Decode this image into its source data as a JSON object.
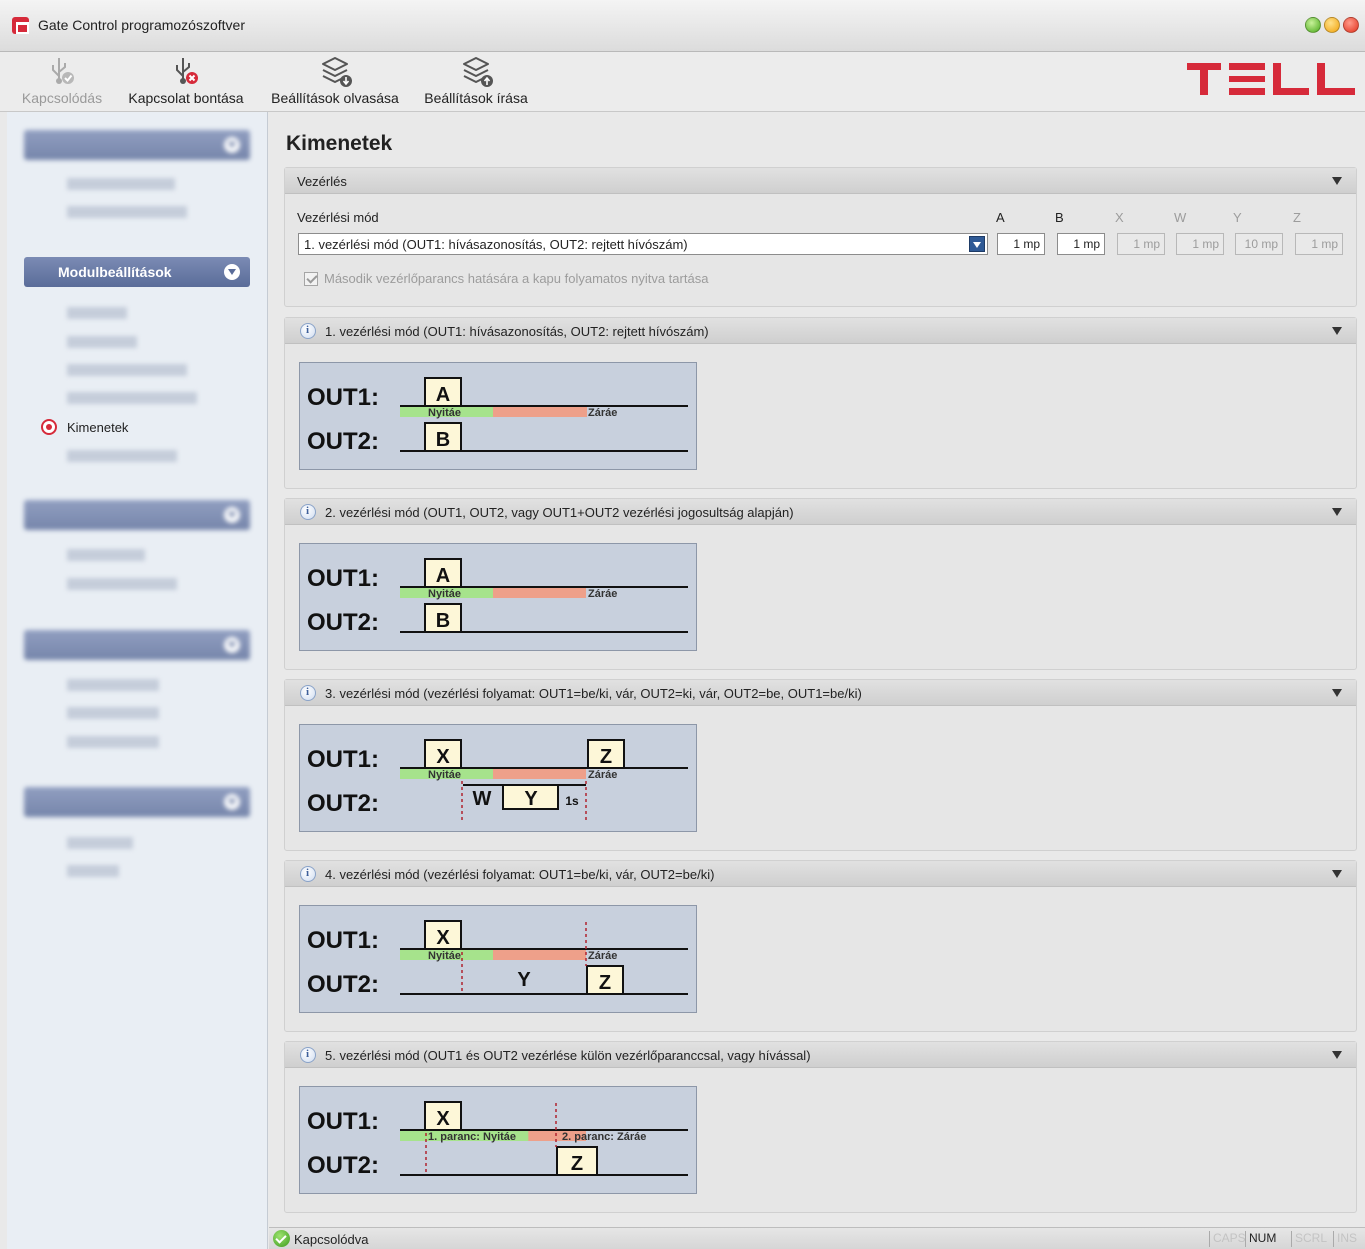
{
  "window": {
    "title": "Gate Control programozószoftver"
  },
  "toolbar": {
    "connect_label": "Kapcsolódás",
    "disconnect_label": "Kapcsolat bontása",
    "read_label": "Beállítások olvasása",
    "write_label": "Beállítások írása",
    "logo_text": "TELL"
  },
  "sidebar": {
    "active_group": "Modulbeállítások",
    "active_item": "Kimenetek"
  },
  "main": {
    "title": "Kimenetek",
    "control": {
      "header": "Vezérlés",
      "mode_label": "Vezérlési mód",
      "mode_value": "1. vezérlési mód   (OUT1: hívásazonosítás, OUT2: rejtett hívószám)",
      "timers": [
        {
          "label": "A",
          "value": "1 mp",
          "enabled": true
        },
        {
          "label": "B",
          "value": "1 mp",
          "enabled": true
        },
        {
          "label": "X",
          "value": "1 mp",
          "enabled": false
        },
        {
          "label": "W",
          "value": "1 mp",
          "enabled": false
        },
        {
          "label": "Y",
          "value": "10 mp",
          "enabled": false
        },
        {
          "label": "Z",
          "value": "1 mp",
          "enabled": false
        }
      ],
      "checkbox_label": "Második vezérlőparancs hatására a kapu folyamatos nyitva tartása"
    },
    "modes": [
      {
        "title": "1. vezérlési mód   (OUT1: hívásazonosítás, OUT2: rejtett hívószám)"
      },
      {
        "title": "2. vezérlési mód   (OUT1, OUT2, vagy OUT1+OUT2 vezérlési jogosultság alapján)"
      },
      {
        "title": "3. vezérlési mód   (vezérlési folyamat: OUT1=be/ki, vár, OUT2=ki, vár, OUT2=be, OUT1=be/ki)"
      },
      {
        "title": "4. vezérlési mód   (vezérlési folyamat: OUT1=be/ki, vár, OUT2=be/ki)"
      },
      {
        "title": "5. vezérlési mód   (OUT1 és OUT2 vezérlése külön vezérlőparanccsal, vagy hívással)"
      }
    ],
    "diagram_text": {
      "out1": "OUT1:",
      "out2": "OUT2:",
      "open": "Nyitáe",
      "close": "Záráe",
      "a": "A",
      "b": "B",
      "x": "X",
      "w": "W",
      "y": "Y",
      "z": "Z",
      "one_s": "1s",
      "cmd1": "1. paranc: Nyitáe",
      "cmd2": "2. paranc: Záráe"
    }
  },
  "status": {
    "text": "Kapcsolódva",
    "caps": "CAPS",
    "num": "NUM",
    "scrl": "SCRL",
    "ins": "INS"
  },
  "colors": {
    "accent": "#d62a3a",
    "sidebar_group": "#6677a6",
    "open_bar": "#a6e38c",
    "close_bar": "#eea08a",
    "pulse_box": "#fdf7d8",
    "diagram_bg": "#c8d0dd"
  }
}
